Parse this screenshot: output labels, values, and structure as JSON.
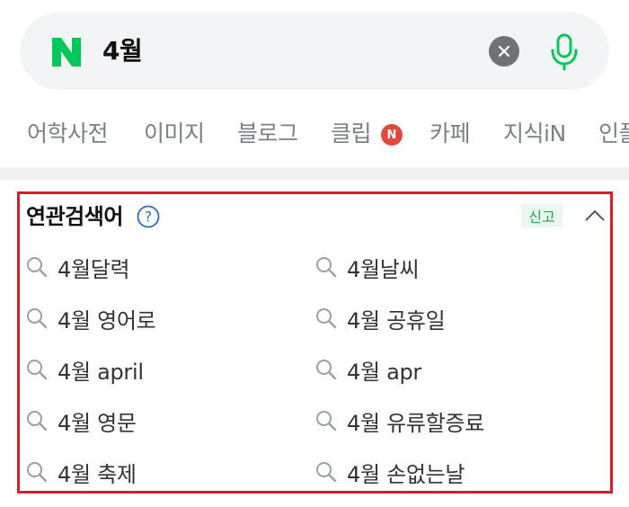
{
  "search": {
    "logo_letter": "N",
    "query": "4월"
  },
  "tabs": [
    {
      "label": "어학사전"
    },
    {
      "label": "이미지"
    },
    {
      "label": "블로그"
    },
    {
      "label": "클립",
      "badge": "N"
    },
    {
      "label": "카페"
    },
    {
      "label": "지식iN"
    },
    {
      "label": "인플"
    }
  ],
  "related": {
    "title": "연관검색어",
    "help_symbol": "?",
    "report_label": "신고",
    "items": [
      {
        "label": "4월달력"
      },
      {
        "label": "4월날씨"
      },
      {
        "label": "4월 영어로"
      },
      {
        "label": "4월 공휴일"
      },
      {
        "label": "4월 april"
      },
      {
        "label": "4월 apr"
      },
      {
        "label": "4월 영문"
      },
      {
        "label": "4월 유류할증료"
      },
      {
        "label": "4월 축제"
      },
      {
        "label": "4월 손없는날"
      }
    ]
  },
  "colors": {
    "brand_green": "#03c75a",
    "highlight_border": "#d21f2a",
    "badge_red": "#e0493c"
  }
}
